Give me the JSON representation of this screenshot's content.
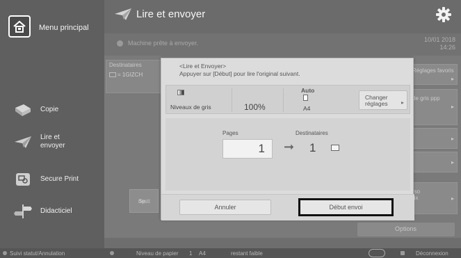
{
  "sidebar": {
    "home_label": "Menu principal",
    "items": [
      {
        "label": "Copie",
        "icon": "copy-icon"
      },
      {
        "label": "Lire et envoyer",
        "label_line1": "Lire et",
        "label_line2": "envoyer",
        "icon": "send-icon"
      },
      {
        "label": "Secure Print",
        "icon": "secure-print-icon"
      },
      {
        "label": "Didacticiel",
        "icon": "tutorial-icon"
      }
    ]
  },
  "header": {
    "title": "Lire et envoyer",
    "status": "Machine prête à envoyer.",
    "date": "10/01 2018",
    "time": "14:26"
  },
  "background": {
    "destinations_label": "Destinataires",
    "destinations_value": "= 1GIZCH",
    "right_cards": [
      "Réglages favoris",
      "de gris ppp",
      "",
      "",
      "rso ux"
    ],
    "special_label_1": "Sp",
    "special_label_2": "desti",
    "options_label": "Options"
  },
  "dialog": {
    "title": "<Lire et Envoyer>",
    "message": "Appuyer sur [Début] pour lire l'original suivant.",
    "gray_label": "Niveaux de gris",
    "zoom": "100%",
    "auto_label": "Auto",
    "paper_size": "A4",
    "change_settings_line1": "Changer",
    "change_settings_line2": "réglages",
    "pages_label": "Pages",
    "destinations_label": "Destinataires",
    "pages_count": "1",
    "destinations_count": "1",
    "cancel_label": "Annuler",
    "start_label": "Début envoi"
  },
  "bottom_bar": {
    "job_status": "Suivi statut/Annulation",
    "paper_level": "Niveau de papier",
    "paper_tray": "1",
    "paper_size": "A4",
    "paper_state": "restant faible",
    "logout": "Déconnexion"
  },
  "colors": {
    "overlay_gray": "#6e6e6e",
    "dialog_bg": "#dcdcdc",
    "highlight_border": "#111111"
  }
}
